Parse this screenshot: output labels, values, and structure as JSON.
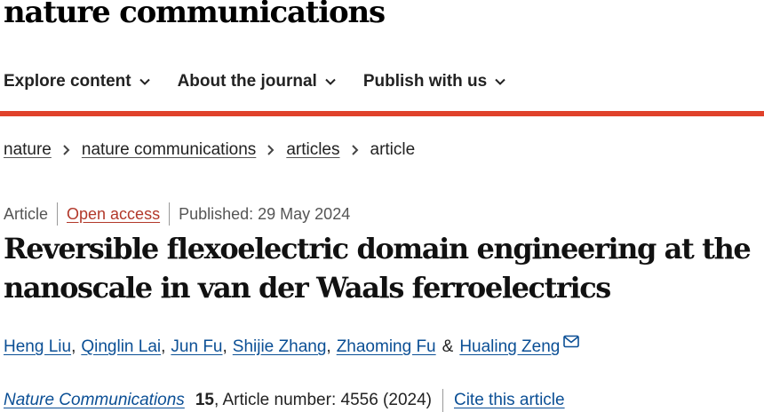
{
  "site": {
    "brand": "nature communications"
  },
  "nav": {
    "items": [
      {
        "label": "Explore content",
        "icon": "chevron-down-icon"
      },
      {
        "label": "About the journal",
        "icon": "chevron-down-icon"
      },
      {
        "label": "Publish with us",
        "icon": "chevron-down-icon"
      }
    ]
  },
  "colors": {
    "accent_bar": "#e0412a",
    "link": "#0b4f95",
    "open_access": "#b2382a"
  },
  "breadcrumb": {
    "items": [
      "nature",
      "nature communications",
      "articles"
    ],
    "current": "article"
  },
  "meta": {
    "type": "Article",
    "access": "Open access",
    "published": "Published: 29 May 2024"
  },
  "article": {
    "title_line1": "Reversible flexoelectric domain engineering at the",
    "title_line2": "nanoscale in van der Waals ferroelectrics"
  },
  "authors": {
    "names": [
      "Heng Liu",
      "Qinglin Lai",
      "Jun Fu",
      "Shijie Zhang",
      "Zhaoming Fu",
      "Hualing Zeng"
    ],
    "amp": "&",
    "mail_icon": "mail-icon"
  },
  "citation": {
    "journal": "Nature Communications",
    "volume": "15",
    "details": ", Article number: 4556 (2024)",
    "cite_label": "Cite this article"
  }
}
